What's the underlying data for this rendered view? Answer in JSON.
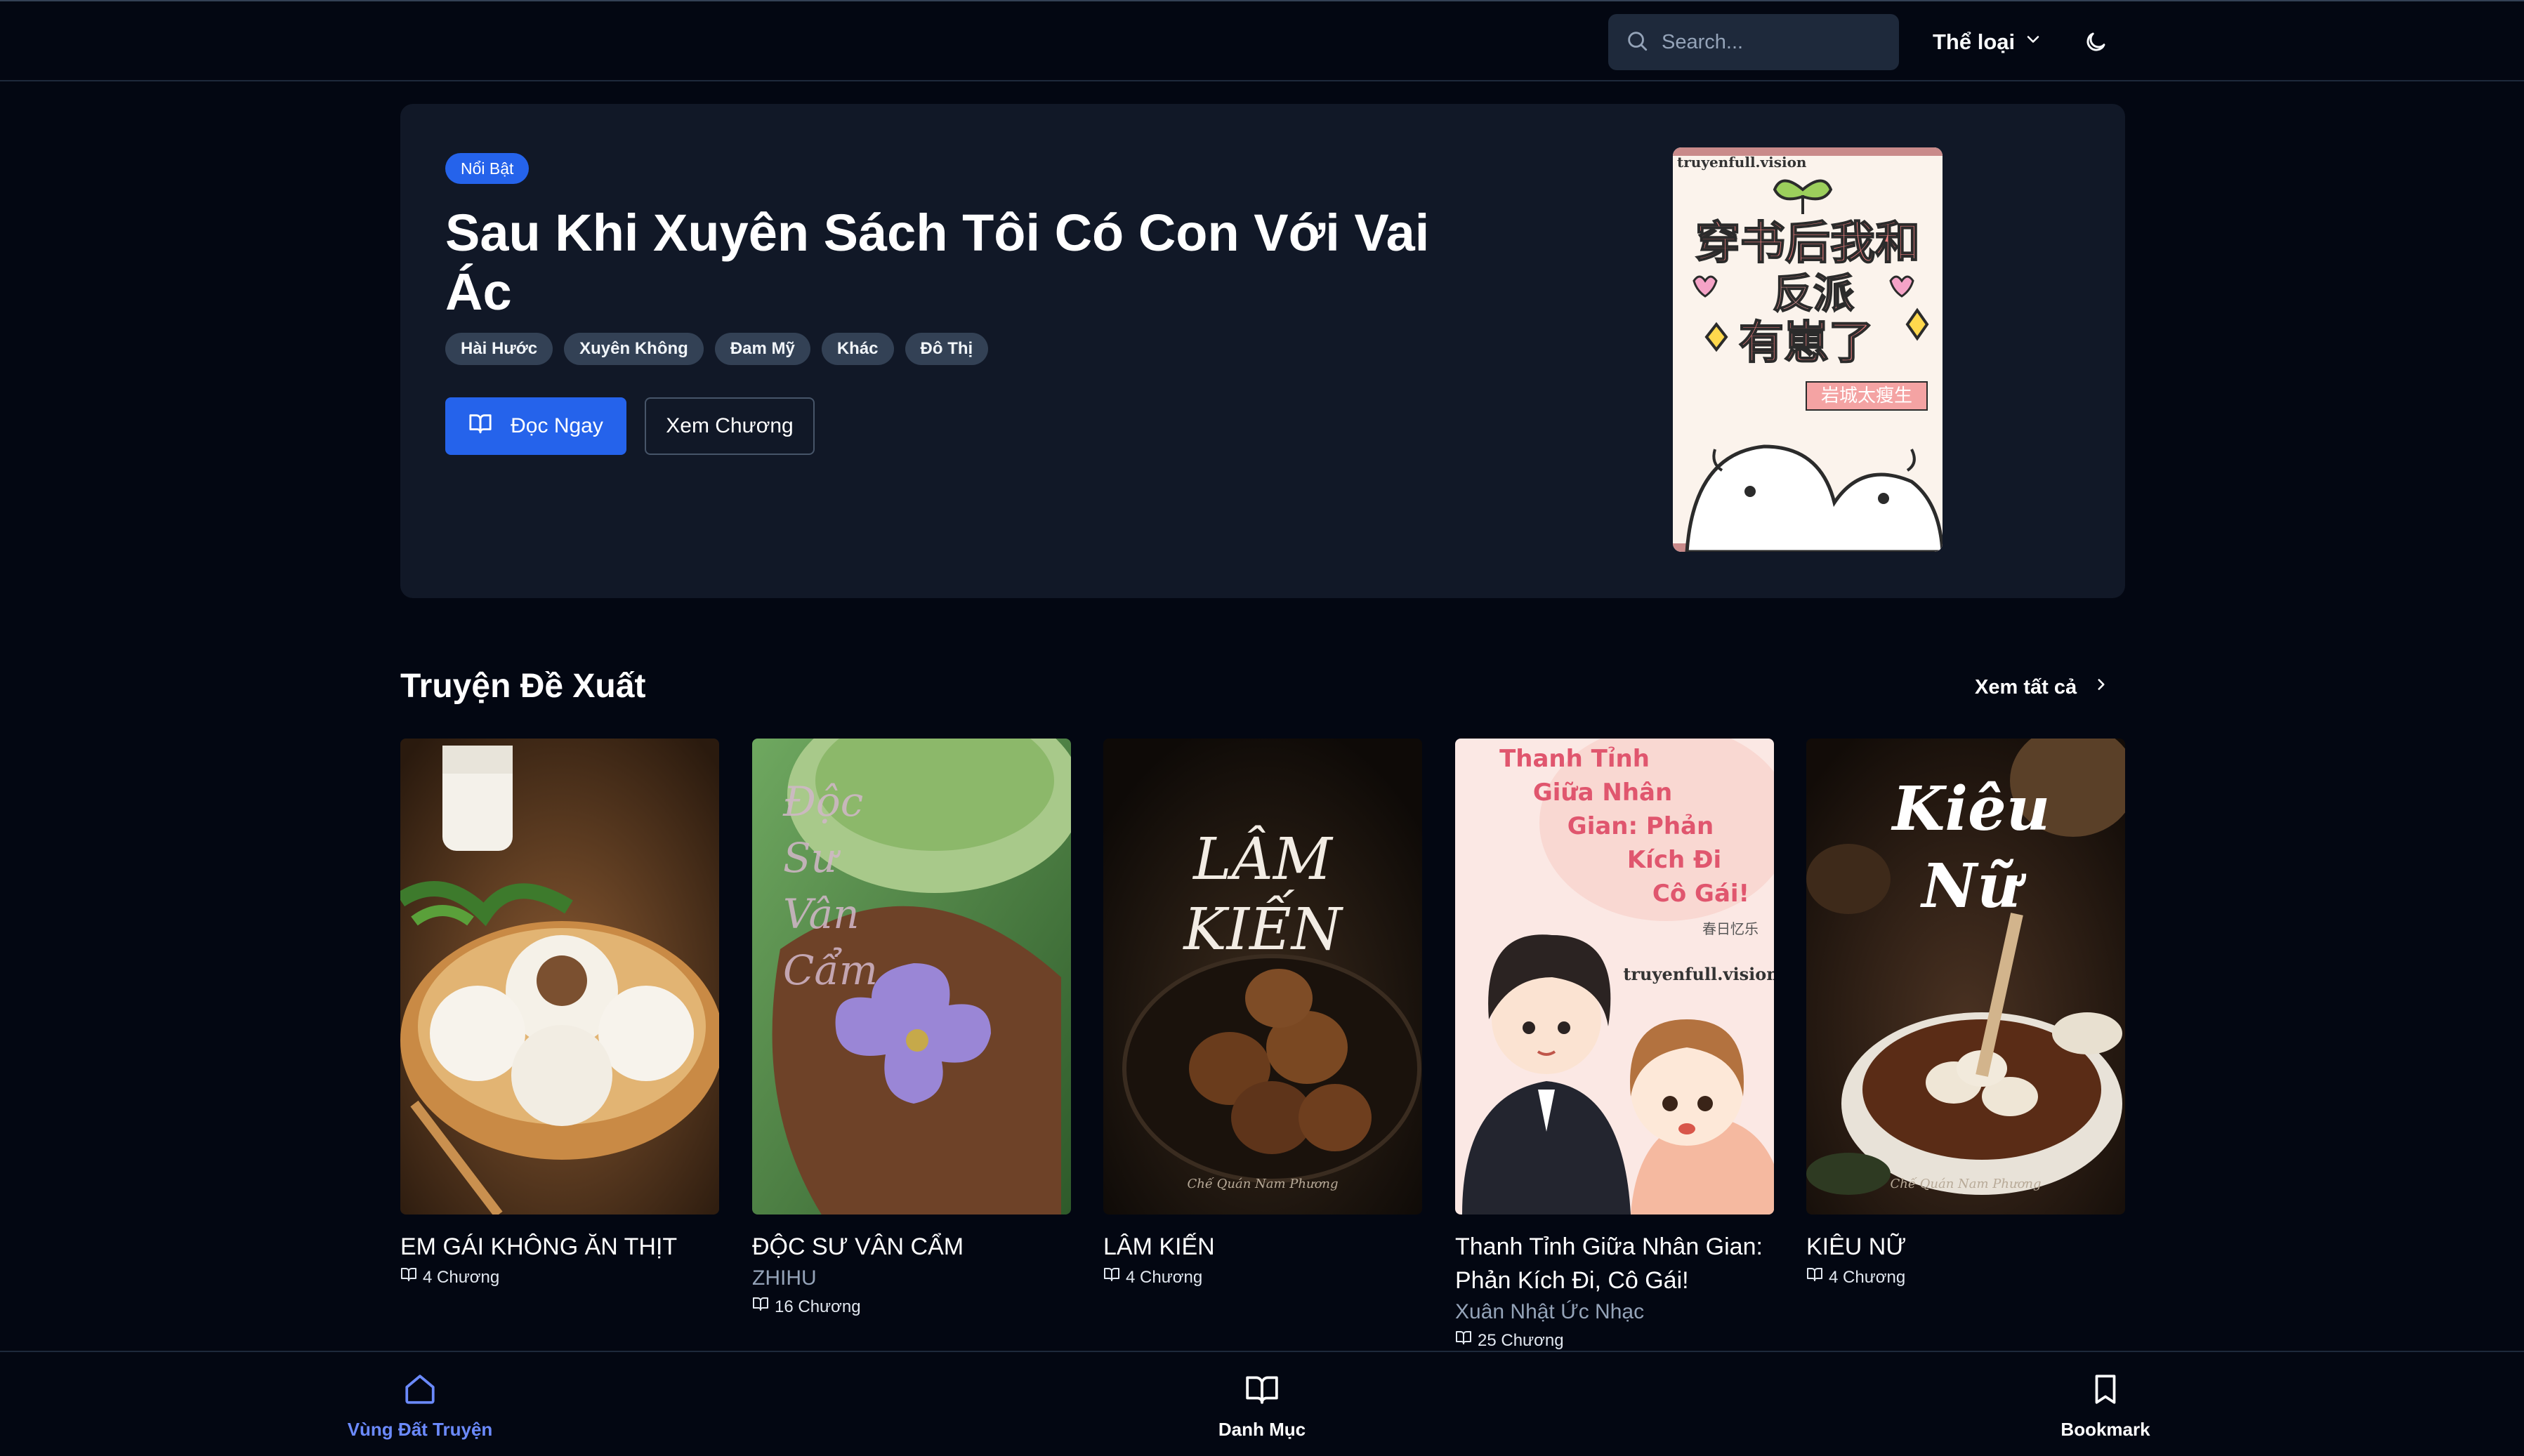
{
  "header": {
    "search_placeholder": "Search...",
    "genre_label": "Thể loại",
    "icons": {
      "search": "search-icon",
      "genre": "chevron-down-icon",
      "theme": "moon-icon"
    }
  },
  "hero": {
    "badge": "Nổi Bật",
    "title": "Sau Khi Xuyên Sách Tôi Có Con Với Vai Ác",
    "tags": [
      "Hài Hước",
      "Xuyên Không",
      "Đam Mỹ",
      "Khác",
      "Đô Thị"
    ],
    "read_button": "Đọc Ngay",
    "chapters_button": "Xem Chương",
    "cover": {
      "watermark": "truyenfull.vision",
      "title_lines": [
        "穿书后我和",
        "反派",
        "有崽了"
      ],
      "author_tag": "岩城太瘦生"
    }
  },
  "section": {
    "title": "Truyện Đề Xuất",
    "see_all": "Xem tất cả"
  },
  "cards": [
    {
      "title": "EM GÁI KHÔNG ĂN THỊT",
      "author": "",
      "chapters": "4 Chương",
      "cover_text": []
    },
    {
      "title": "ĐỘC SƯ VÂN CẨM",
      "author": "ZHIHU",
      "chapters": "16 Chương",
      "cover_text": [
        "Độc",
        "Sư",
        "Vân",
        "Cẩm"
      ]
    },
    {
      "title": "LÂM KIẾN",
      "author": "",
      "chapters": "4 Chương",
      "cover_text": [
        "LÂM",
        "KIẾN"
      ],
      "cover_signature": "Chế Quán Nam Phương"
    },
    {
      "title": "Thanh Tỉnh Giữa Nhân Gian: Phản Kích Đi, Cô Gái!",
      "author": "Xuân Nhật Ức Nhạc",
      "chapters": "25 Chương",
      "cover_text": [
        "Thanh Tỉnh",
        "Giữa Nhân",
        "Gian: Phản",
        "Kích Đi",
        "Cô Gái!"
      ],
      "cover_small": "春日忆乐",
      "cover_watermark": "truyenfull.vision"
    },
    {
      "title": "KIÊU NỮ",
      "author": "",
      "chapters": "4 Chương",
      "cover_text": [
        "Kiêu",
        "Nữ"
      ],
      "cover_signature": "Chế Quán Nam Phương"
    }
  ],
  "bottom_nav": [
    {
      "label": "Vùng Đất Truyện",
      "icon": "home-icon",
      "active": true
    },
    {
      "label": "Danh Mục",
      "icon": "book-open-icon",
      "active": false
    },
    {
      "label": "Bookmark",
      "icon": "bookmark-icon",
      "active": false
    }
  ],
  "colors": {
    "accent": "#2563eb",
    "background": "#030712",
    "panel": "#111827",
    "active_nav": "#6b8afd"
  }
}
